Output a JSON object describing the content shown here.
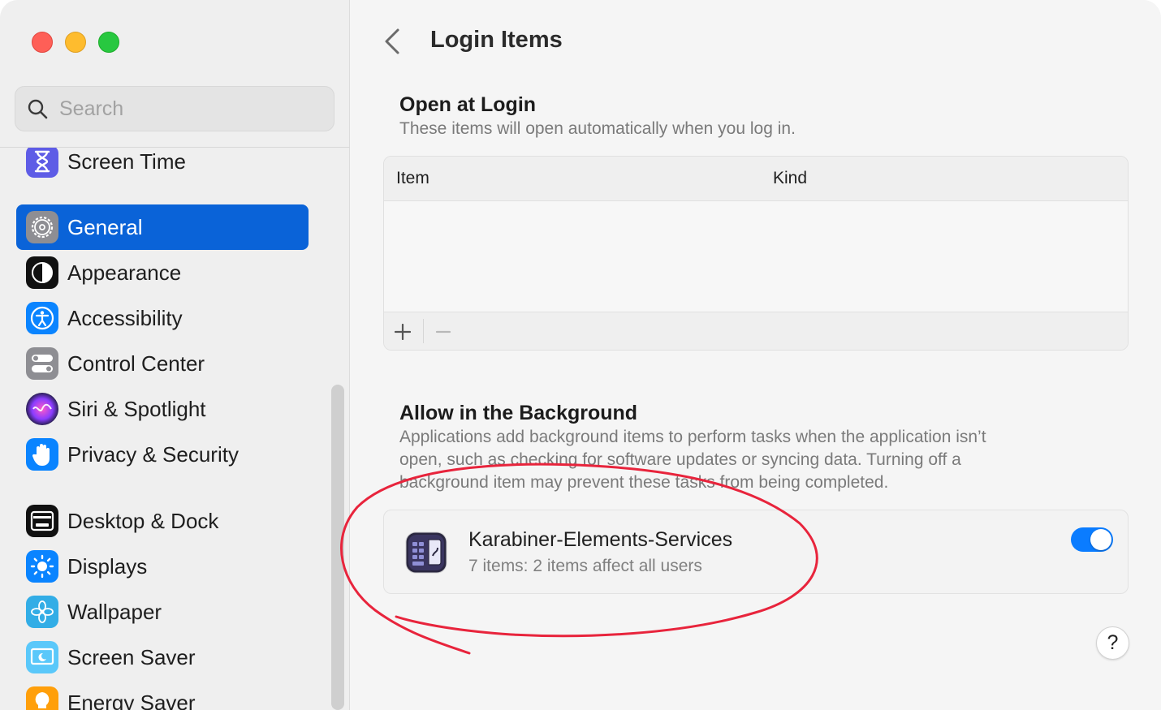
{
  "window": {
    "controls": [
      "close",
      "minimize",
      "zoom"
    ]
  },
  "sidebar": {
    "search_placeholder": "Search",
    "items": [
      {
        "label": "Screen Time",
        "icon": "hourglass-icon",
        "color": "#5e5ce6",
        "active": false
      },
      {
        "label": "General",
        "icon": "gear-icon",
        "color": "#8e8e93",
        "active": true
      },
      {
        "label": "Appearance",
        "icon": "appearance-icon",
        "color": "#000000",
        "active": false
      },
      {
        "label": "Accessibility",
        "icon": "accessibility-icon",
        "color": "#0a84ff",
        "active": false
      },
      {
        "label": "Control Center",
        "icon": "control-center-icon",
        "color": "#8e8e93",
        "active": false
      },
      {
        "label": "Siri & Spotlight",
        "icon": "siri-icon",
        "color": "#c040ff",
        "active": false
      },
      {
        "label": "Privacy & Security",
        "icon": "hand-icon",
        "color": "#0a84ff",
        "active": false
      },
      {
        "label": "Desktop & Dock",
        "icon": "dock-icon",
        "color": "#000000",
        "active": false
      },
      {
        "label": "Displays",
        "icon": "sun-icon",
        "color": "#0a84ff",
        "active": false
      },
      {
        "label": "Wallpaper",
        "icon": "flower-icon",
        "color": "#32ade6",
        "active": false
      },
      {
        "label": "Screen Saver",
        "icon": "screen-saver-icon",
        "color": "#5ac8fa",
        "active": false
      },
      {
        "label": "Energy Saver",
        "icon": "lightbulb-icon",
        "color": "#ff9f0a",
        "active": false
      }
    ]
  },
  "main": {
    "title": "Login Items",
    "open_at_login": {
      "title": "Open at Login",
      "description": "These items will open automatically when you log in.",
      "columns": [
        "Item",
        "Kind"
      ],
      "add_label": "+",
      "remove_label": "−"
    },
    "background": {
      "title": "Allow in the Background",
      "description_lines": [
        "Applications add background items to perform tasks when the application isn’t",
        "open, such as checking for software updates or syncing data. Turning off a",
        "background item may prevent these tasks from being completed."
      ],
      "items": [
        {
          "name": "Karabiner-Elements-Services",
          "detail": "7 items: 2 items affect all users",
          "enabled": true
        }
      ]
    },
    "help_label": "?"
  },
  "colors": {
    "accent": "#0a63d8",
    "toggle_on": "#0a7cff",
    "annotation": "#e8243c"
  }
}
